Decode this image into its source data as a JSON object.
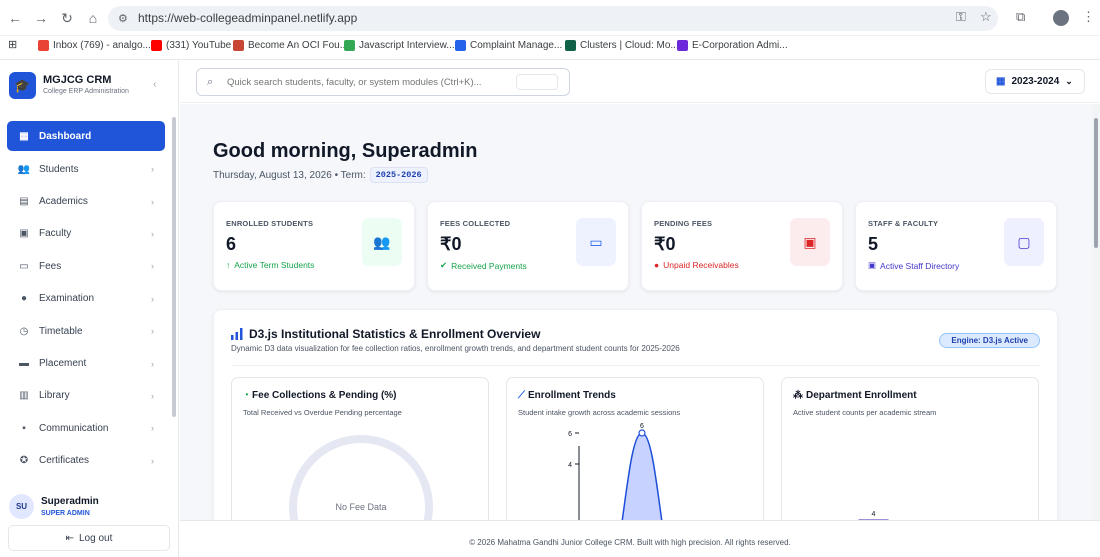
{
  "browser": {
    "url": "https://web-collegeadminpanel.netlify.app",
    "bookmarks": [
      {
        "label": "Inbox (769) - analgo...",
        "color": "#ea4335"
      },
      {
        "label": "(331) YouTube",
        "color": "#ff0000"
      },
      {
        "label": "Become An OCI Fou...",
        "color": "#c74634"
      },
      {
        "label": "Javascript Interview...",
        "color": "#34a853"
      },
      {
        "label": "Complaint Manage...",
        "color": "#2563eb"
      },
      {
        "label": "Clusters | Cloud: Mo...",
        "color": "#116149"
      },
      {
        "label": "E-Corporation Admi...",
        "color": "#6d28d9"
      }
    ]
  },
  "sidebar": {
    "brand": "MGJCG CRM",
    "brand_sub": "College ERP Administration",
    "items": [
      {
        "label": "Dashboard",
        "icon": "grid-icon",
        "active": true
      },
      {
        "label": "Students",
        "icon": "users-icon"
      },
      {
        "label": "Academics",
        "icon": "book-icon"
      },
      {
        "label": "Faculty",
        "icon": "id-card-icon"
      },
      {
        "label": "Fees",
        "icon": "cash-icon"
      },
      {
        "label": "Examination",
        "icon": "bulb-icon"
      },
      {
        "label": "Timetable",
        "icon": "clock-icon"
      },
      {
        "label": "Placement",
        "icon": "briefcase-icon"
      },
      {
        "label": "Library",
        "icon": "library-icon"
      },
      {
        "label": "Communication",
        "icon": "chat-icon"
      },
      {
        "label": "Certificates",
        "icon": "certificate-icon"
      }
    ],
    "user": {
      "initials": "SU",
      "name": "Superadmin",
      "role": "SUPER ADMIN"
    },
    "logout": "Log out"
  },
  "topbar": {
    "search_placeholder": "Quick search students, faculty, or system modules (Ctrl+K)...",
    "year": "2023-2024"
  },
  "main": {
    "greeting": "Good morning, Superadmin",
    "date": "Thursday, August 13, 2026 • Term:",
    "term": "2025-2026",
    "stats": [
      {
        "label": "ENROLLED STUDENTS",
        "value": "6",
        "sub": "Active Term Students",
        "sub_color": "#16a34a",
        "sub_icon": "arrow-up-icon",
        "icon": "users-icon",
        "icon_color": "#16a34a",
        "icon_bg": "#ecfdf3"
      },
      {
        "label": "FEES COLLECTED",
        "value": "₹0",
        "sub": "Received Payments",
        "sub_color": "#16a34a",
        "sub_icon": "check-circle-icon",
        "icon": "wallet-icon",
        "icon_color": "#2563eb",
        "icon_bg": "#eef2ff"
      },
      {
        "label": "PENDING FEES",
        "value": "₹0",
        "sub": "Unpaid Receivables",
        "sub_color": "#dc2626",
        "sub_icon": "alert-circle-icon",
        "icon": "banknote-icon",
        "icon_color": "#dc2626",
        "icon_bg": "#fdecee"
      },
      {
        "label": "STAFF & FACULTY",
        "value": "5",
        "sub": "Active Staff Directory",
        "sub_color": "#4338ca",
        "sub_icon": "badge-icon",
        "icon": "contact-icon",
        "icon_color": "#4338ca",
        "icon_bg": "#eef0ff"
      }
    ],
    "panel": {
      "title": "D3.js Institutional Statistics & Enrollment Overview",
      "subtitle": "Dynamic D3 data visualization for fee collection ratios, enrollment growth trends, and department student counts for 2025-2026",
      "engine": "Engine: D3.js Active"
    }
  },
  "chart_data": [
    {
      "type": "pie",
      "title": "Fee Collections & Pending (%)",
      "subtitle": "Total Received vs Overdue Pending percentage",
      "empty_label": "No Fee Data",
      "values": []
    },
    {
      "type": "area",
      "title": "Enrollment Trends",
      "subtitle": "Student intake growth across academic sessions",
      "y_ticks": [
        4,
        6
      ],
      "peak_label": "6",
      "values": [
        0,
        6,
        0
      ]
    },
    {
      "type": "bar",
      "title": "Department Enrollment",
      "subtitle": "Active student counts per academic stream",
      "values": [
        4
      ],
      "data_labels": [
        "4"
      ]
    }
  ],
  "footer": "© 2026 Mahatma Gandhi Junior College CRM. Built with high precision. All rights reserved.",
  "colors": {
    "accent": "#2155d9",
    "chart_fill": "#c7d2fe",
    "chart_stroke": "#1d4ed8",
    "bar": "#4f2fdc"
  }
}
